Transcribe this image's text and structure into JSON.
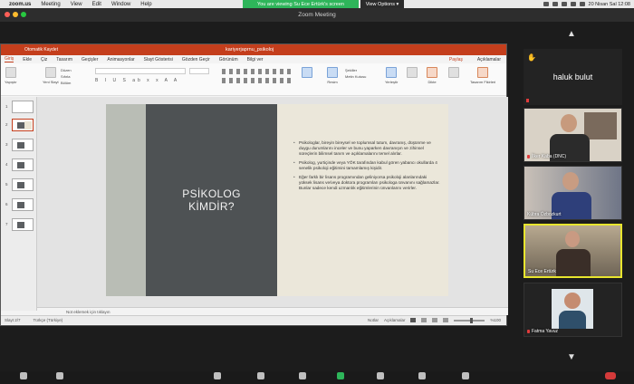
{
  "mac_menu": {
    "apple": "",
    "app": "zoom.us",
    "items": [
      "Meeting",
      "View",
      "Edit",
      "Window",
      "Help"
    ],
    "share_notice": "You are viewing Su Ece Ertürk's screen",
    "view_options": "View Options",
    "clock": "20 Nisan Sal 12:08"
  },
  "window": {
    "title": "Zoom Meeting"
  },
  "ppt": {
    "autosave": "Otomatik Kaydet",
    "doc_name": "kariyerjaprnu_psikoloj",
    "tabs": [
      "Giriş",
      "Ekle",
      "Çiz",
      "Tasarım",
      "Geçişler",
      "Animasyonlar",
      "Slayt Gösterisi",
      "Gözden Geçir",
      "Görünüm",
      "Bilgi ver"
    ],
    "share": "Paylaş",
    "comments": "Açıklamalar",
    "ribbon": {
      "paste": "Yapıştır",
      "new_slide": "Yeni Slayt",
      "layout": "Düzen",
      "reset": "Sıfırla",
      "section": "Bölüm",
      "arrange": "Düzenle",
      "shapes": "Şekiller",
      "picture": "Resim",
      "textbox": "Metin Kutusu",
      "dictate": "Dikte",
      "reuse": "Slaytları Yeniden Kullan",
      "designer": "Tasarım Fikirleri",
      "idea": "Fikirleri",
      "sensitivity": "Duyarlılık",
      "arrange2": "Yerleştir"
    },
    "thumbnails": [
      "1",
      "2",
      "3",
      "4",
      "5",
      "6",
      "7"
    ],
    "slide": {
      "title_line1": "PSİKOLOG",
      "title_line2": "KİMDİR?",
      "bullets": [
        "Psikologlar, bireyin bireysel ve toplumsal tutum, davranış, düşünme ve duygu durumlarını inceler ve bunu yaparken davranışın ve zihinsel süreçlerin bilimsel tanım ve açıklamalarını temel alırlar.",
        "Psikolog, yurtiçinde veya YÖK tarafından kabul gören yabancı okullarda 4 senelik psikoloji eğitimini tamamlamış kişidir.",
        "Eğer farklı bir lisans programından geliniyorsa psikoloji alanlarındaki yüksek lisans ve/veya doktora programları psikologa ünvanını sağlamazlar. Bunlar sadece kendi uzmanlık eğitimlerinin ünvanlarını verirler."
      ]
    },
    "notes": "Not eklemek için tıklayın",
    "status": {
      "slide": "Slayt 2/7",
      "lang": "Türkçe (Türkiye)",
      "notes_btn": "Notlar",
      "comments_btn": "Açıklamalar",
      "zoom": "%100"
    }
  },
  "participants": {
    "haluk": "haluk bulut",
    "tiles": [
      {
        "name": "İlker Kaba (DNC)"
      },
      {
        "name": "Kübra Özbozkurt"
      },
      {
        "name": "Su Ece Ertürk"
      },
      {
        "name": "Fatma Yavuz"
      }
    ]
  },
  "colors": {
    "ppt_red": "#c43e1c",
    "zoom_green": "#2eb55a",
    "active_speaker": "#e8e52e",
    "slide_dark": "#4e5254",
    "slide_cream": "#ebe7da"
  }
}
